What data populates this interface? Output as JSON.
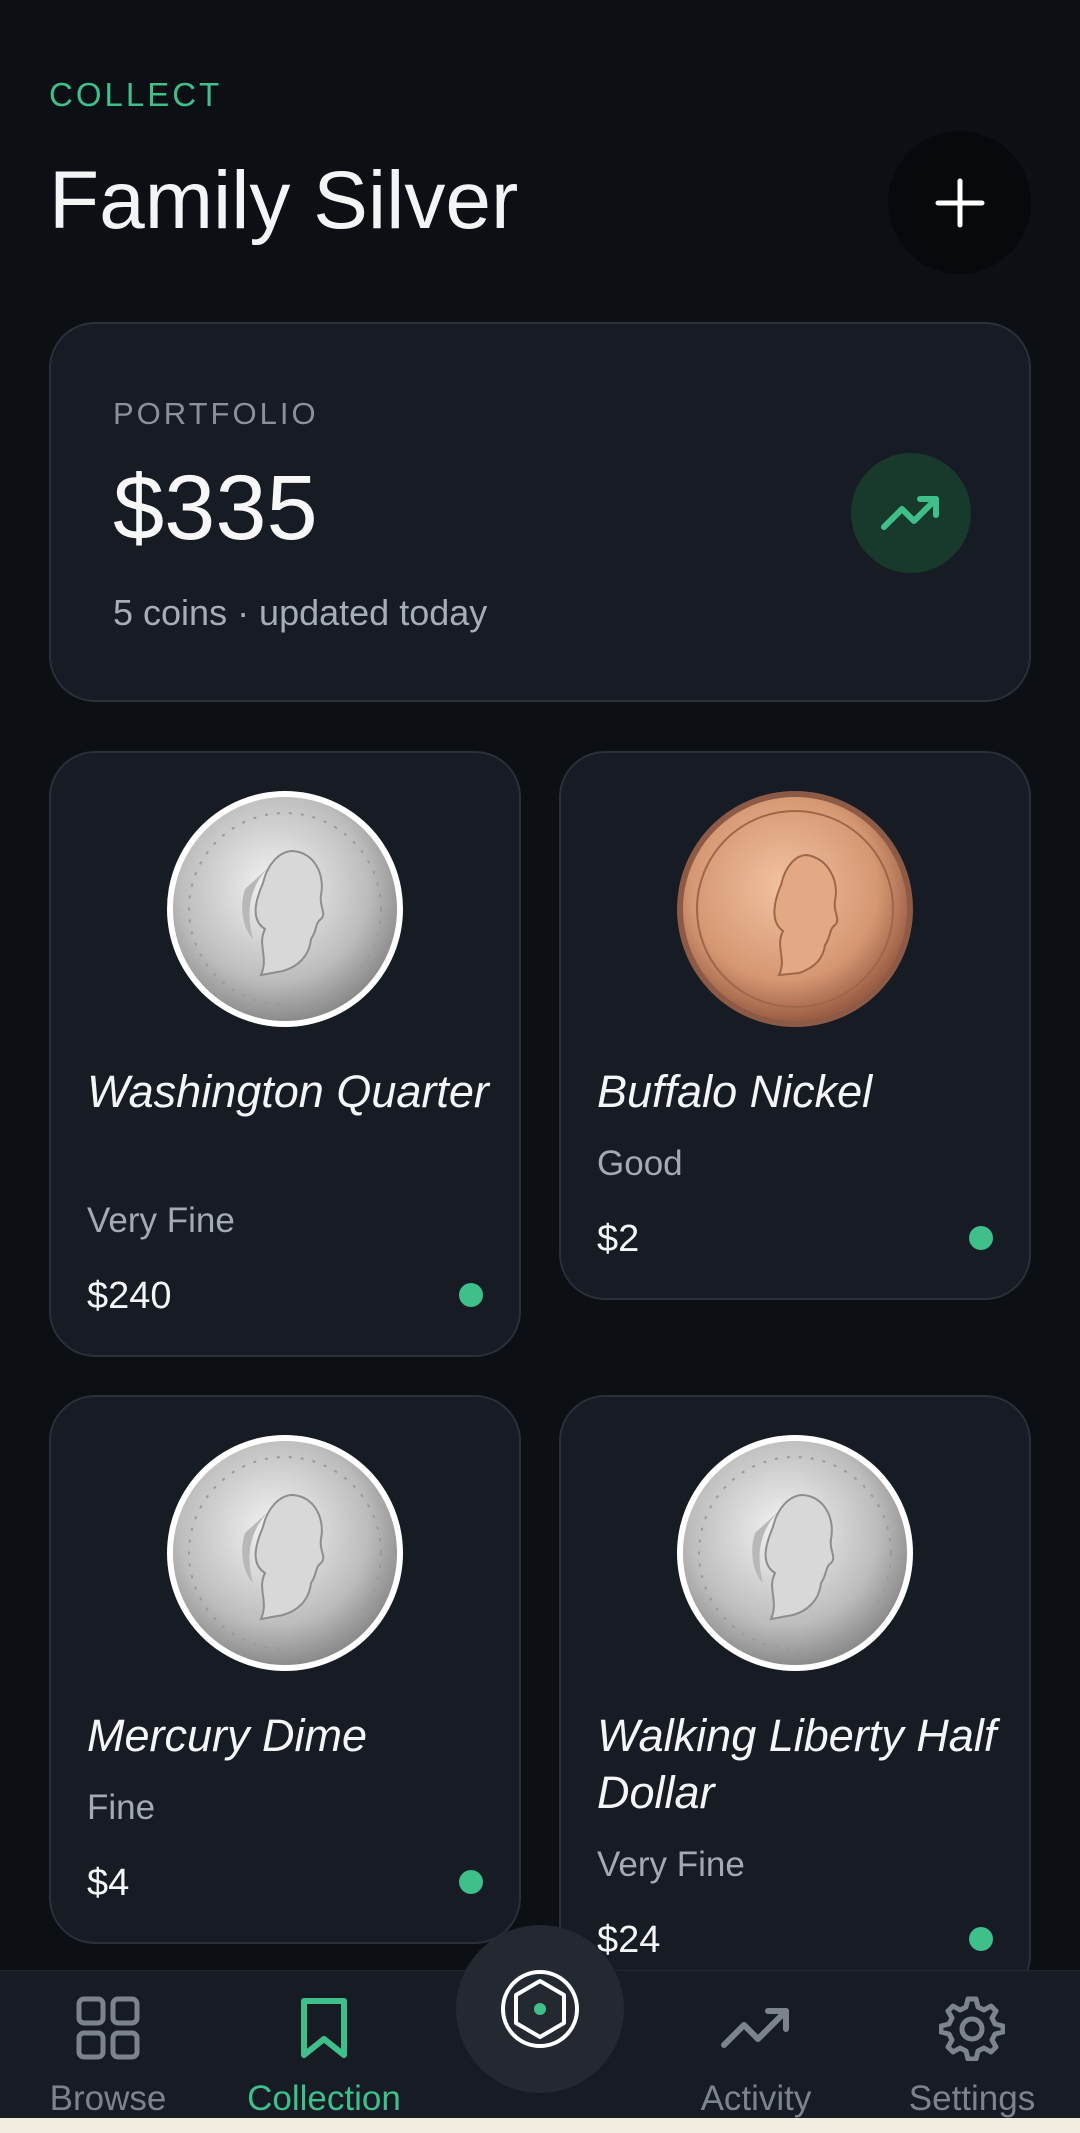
{
  "header": {
    "eyebrow": "COLLECT",
    "title": "Family Silver",
    "add_icon": "plus-icon"
  },
  "portfolio": {
    "label": "PORTFOLIO",
    "value": "$335",
    "subtitle": "5 coins · updated today",
    "trend_icon": "trending-up-icon"
  },
  "coins": [
    {
      "name": "Washington Quarter",
      "grade": "Very Fine",
      "price": "$240",
      "image": "silver-liberty-coin"
    },
    {
      "name": "Buffalo Nickel",
      "grade": "Good",
      "price": "$2",
      "image": "copper-penny-coin"
    },
    {
      "name": "Mercury Dime",
      "grade": "Fine",
      "price": "$4",
      "image": "silver-liberty-coin"
    },
    {
      "name": "Walking Liberty Half Dollar",
      "grade": "Very Fine",
      "price": "$24",
      "image": "silver-liberty-coin"
    }
  ],
  "nav": {
    "items": [
      {
        "label": "Browse",
        "icon": "grid-icon"
      },
      {
        "label": "Collection",
        "icon": "bookmark-icon",
        "active": true
      },
      {
        "label": "Activity",
        "icon": "trending-up-icon"
      },
      {
        "label": "Settings",
        "icon": "gear-icon"
      }
    ],
    "center_icon": "hexagon-scan-icon"
  },
  "colors": {
    "background": "#0c0f14",
    "card": "#171b23",
    "accent": "#3fbf8a"
  }
}
